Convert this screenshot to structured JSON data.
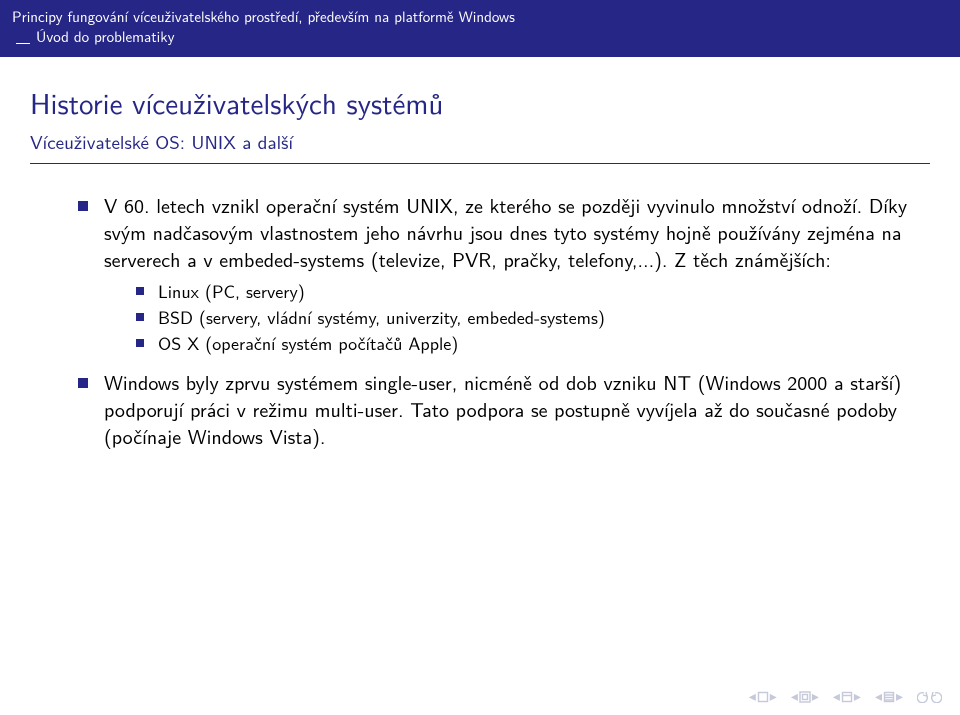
{
  "header": {
    "presentation_title": "Principy fungování víceuživatelského prostředí, především na platformě Windows",
    "section": "Úvod do problematiky"
  },
  "frame": {
    "title": "Historie víceuživatelských systémů",
    "subtitle": "Víceuživatelské OS: UNIX a další"
  },
  "bullets": [
    {
      "text": "V 60. letech vznikl operační systém UNIX, ze kterého se později vyvinulo množství odnoží. Díky svým nadčasovým vlastnostem jeho návrhu jsou dnes tyto systémy hojně používány zejména na serverech a v embeded-systems (televize, PVR, pračky, telefony,...). Z těch známějších:",
      "sub": [
        "Linux (PC, servery)",
        "BSD (servery, vládní systémy, univerzity, embeded-systems)",
        "OS X (operační systém počítačů Apple)"
      ]
    },
    {
      "text": "Windows byly zprvu systémem single-user, nicméně od dob vzniku NT (Windows 2000 a starší) podporují práci v režimu multi-user. Tato podpora se postupně vyvíjela až do současné podoby (počínaje Windows Vista)."
    }
  ]
}
